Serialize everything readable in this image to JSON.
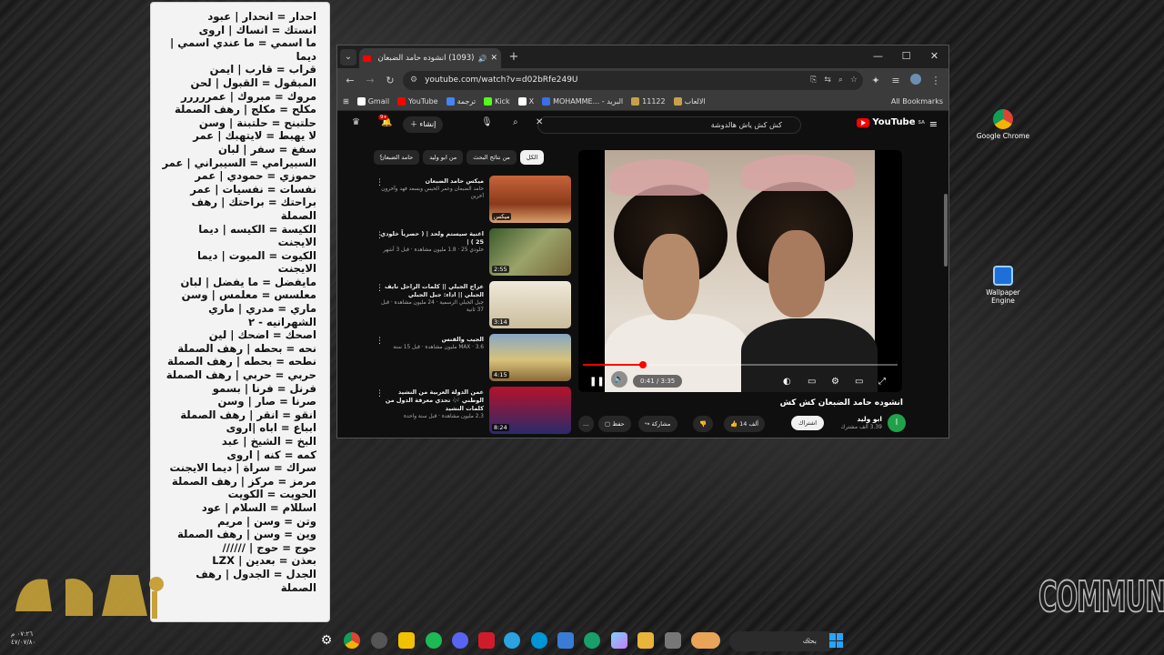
{
  "notes": {
    "lines": [
      "احدار = انحدار | عبود",
      "انستك = انساك | اروى",
      "ما اسمي = ما عندي اسمي | ديما",
      "قراب = قارب | ايمن",
      "المبقول = القبول | لحن",
      "مروك = مبروك | عمررررر",
      "مكلح = مكلج | رهف الصملة",
      "حلتبنح = حلتبنة | وسن",
      "لا يهبط = لايتهبك | عمر",
      "سفغ = سفر | لبان",
      "السبيرامي = السيبراني | عمر",
      "حموزي = حمودي | عمر",
      "نفسات = نفسيات | عمر",
      "براحتك = براحتك | رهف الصملة",
      "الكيسة = الكيسه | ديما الايجنت",
      "الكيوت = الميوت | ديما الايجنت",
      "مايفضل = ما يفضل | لبان",
      "معلسس = معلمس | وسن",
      "ماري = مدري | ماري الشهرانيه - ٢",
      "اصحك = اضحك | لين",
      "نحه = بحطه | رهف الصملة",
      "نطحه = بحطه | رهف الصملة",
      "حربي = حربي | رهف الصملة",
      "فرنل = فرنا | بسمو",
      "صرنا = صار | وسن",
      "انقو = انقر | رهف الصملة",
      "ابباع = اباه |اروى",
      "البخ = الشيخ | عبد",
      "كمه = كنه | اروى",
      "سراك = سراة | ديما الايجنت",
      "مرمز = مركز | رهف الصملة",
      "الحويت = الكويت",
      "اسللام = السلام | عود",
      "وتن = وسن | مريم",
      "وين = وسن | رهف الصملة",
      "حوج = حوج | //////",
      "بعذن = بعدين | LZX",
      "الجدل = الجدول | رهف الصملة"
    ]
  },
  "browser": {
    "tab_title": "(1093) انشوده حامد الضبعان",
    "new_tab": "+",
    "url": "youtube.com/watch?v=d02bRfe249U",
    "bookmarks": [
      {
        "label": "Gmail",
        "color": "#ffffff"
      },
      {
        "label": "YouTube",
        "color": "#ff0000"
      },
      {
        "label": "ترجمة",
        "color": "#4285f4"
      },
      {
        "label": "Kick",
        "color": "#53fc18"
      },
      {
        "label": "X",
        "color": "#ffffff"
      },
      {
        "label": "MOHAMME... - البريد",
        "color": "#3d6ee6"
      },
      {
        "label": "11122",
        "color": "#c8a04a"
      },
      {
        "label": "الالعاب",
        "color": "#c8a04a"
      }
    ],
    "all_bookmarks": "All Bookmarks"
  },
  "youtube": {
    "logo": "YouTube",
    "logo_sup": "SA",
    "search_query": "كش كش ياش هالدوشة",
    "create_label": "إنشاء",
    "notif_count": "9+",
    "chips": [
      "الكل",
      "من نتائج البحث",
      "من ابو وليد",
      "حامد الضبعان"
    ],
    "related": [
      {
        "title": "ميكس حامد الضبعان",
        "meta": "حامد الضبعان وعمر الحيس وبسعد فهد وآخرون آخرين",
        "dur": "ميكس"
      },
      {
        "title": "اغنية سيستم ولحد | ( حصرياً خلودي 25 ) |",
        "meta": "خلودي 25 · 1.8 مليون مشاهدة · قبل 3 أشهر",
        "dur": "2:55"
      },
      {
        "title": "عزاج الجبلي || كلمات الراحل نايف الجبلي || اداء: جبل الجبلي",
        "meta": "جبل الجبلي الرسمية · 24 مليون مشاهدة · قبل 37 ثانية",
        "dur": "3:14"
      },
      {
        "title": "الجيب والقنس",
        "meta": "MAX · 3.6 مليون مشاهدة · قبل 15 سنة",
        "dur": "4:15"
      },
      {
        "title": "عمن الدولة العربية من النشيد الوطني 🎶 تحدي معرفة الدول من كلمات النشيد",
        "meta": "2.3 مليون مشاهدة · قبل سنة واحدة",
        "dur": "8:24"
      }
    ],
    "video_title": "انشوده حامد الضبعان كش كش",
    "time": "0:41 / 3:35",
    "progress": 0.19,
    "channel_name": "ابو وليد",
    "channel_subs": "3.39 ألف مشترك",
    "channel_initial": "ا",
    "subscribe": "اشتراك",
    "likes": "14 ألف",
    "share": "مشاركة",
    "save": "حفظ"
  },
  "desktop": {
    "icons": [
      {
        "label": "Google Chrome"
      },
      {
        "label": "Wallpaper Engine"
      }
    ],
    "community": "COMMUNITY",
    "clock_time": "٠٧:٢٦ م",
    "clock_date": "٤٧/٠٧/٨٠"
  },
  "taskbar": {
    "search_placeholder": "بحث"
  }
}
